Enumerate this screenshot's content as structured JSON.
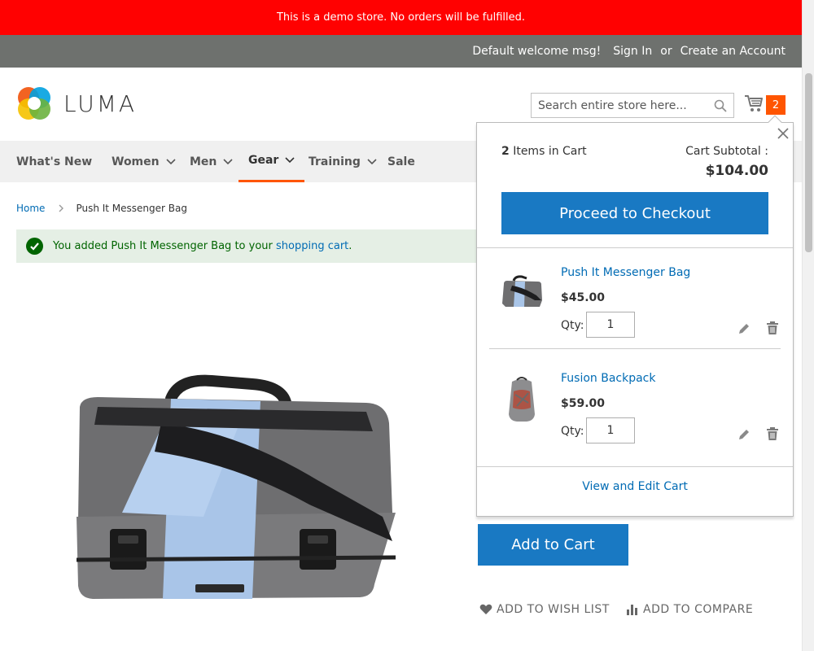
{
  "demo_notice": "This is a demo store. No orders will be fulfilled.",
  "header_links": {
    "welcome": "Default welcome msg!",
    "sign_in": "Sign In",
    "or": "or",
    "create_account": "Create an Account"
  },
  "logo_text": "LUMA",
  "search": {
    "placeholder": "Search entire store here..."
  },
  "cart_count": "2",
  "nav": {
    "items": [
      {
        "label": "What's New"
      },
      {
        "label": "Women"
      },
      {
        "label": "Men"
      },
      {
        "label": "Gear"
      },
      {
        "label": "Training"
      },
      {
        "label": "Sale"
      }
    ],
    "active": "Gear"
  },
  "breadcrumb": {
    "home": "Home",
    "current": "Push It Messenger Bag"
  },
  "message": {
    "prefix": "You added Push It Messenger Bag to your ",
    "link": "shopping cart",
    "suffix": "."
  },
  "minicart": {
    "count": "2",
    "count_label": " Items in Cart",
    "subtotal_label": "Cart Subtotal :",
    "subtotal": "$104.00",
    "checkout_label": "Proceed to Checkout",
    "qty_label": "Qty:",
    "items": [
      {
        "name": "Push It Messenger Bag",
        "price": "$45.00",
        "qty": "1"
      },
      {
        "name": "Fusion Backpack",
        "price": "$59.00",
        "qty": "1"
      }
    ],
    "view_cart": "View and Edit Cart"
  },
  "add_to_cart": "Add to Cart",
  "wish_list": "ADD TO WISH LIST",
  "compare": "ADD TO COMPARE",
  "colors": {
    "demo_red": "#ff0101",
    "header_gray": "#6e716e",
    "primary_blue": "#1979c3",
    "link_blue": "#006bb4",
    "accent_orange": "#ff5501",
    "success_green": "#006400"
  }
}
